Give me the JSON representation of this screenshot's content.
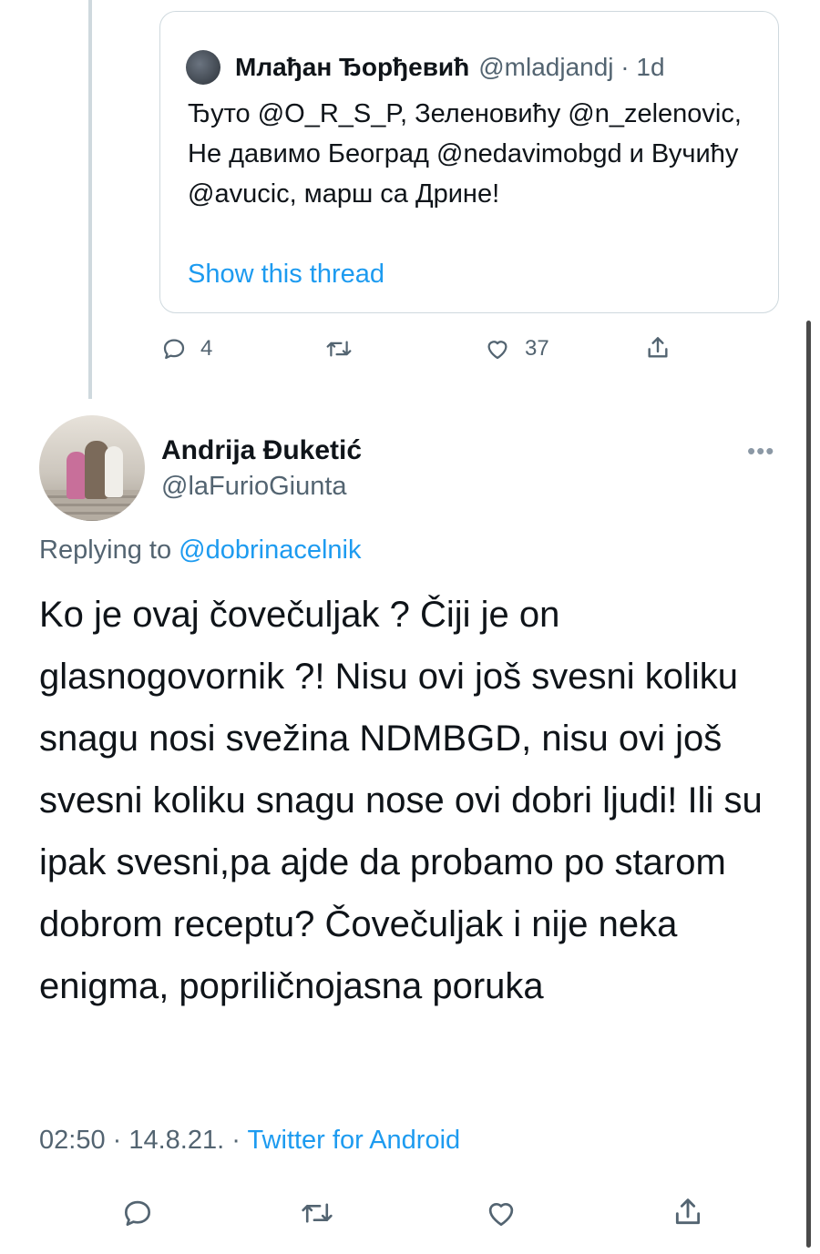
{
  "quoted_tweet": {
    "author_name": "Млађан Ђорђевић",
    "author_handle": "@mladjandj",
    "age": "1d",
    "text": "Ђуто @O_R_S_P, Зеленовићу @n_zelenovic, Не давимо Београд @nedavimobgd и Вучићу @avucic, марш са Дрине!",
    "show_thread": "Show this thread",
    "actions": {
      "reply_count": "4",
      "like_count": "37",
      "icons": [
        "reply-icon",
        "retweet-icon",
        "like-icon",
        "share-icon"
      ]
    }
  },
  "tweet": {
    "author_name": "Andrija Đuketić",
    "author_handle": "@laFurioGiunta",
    "more_label": "•••",
    "replying_prefix": "Replying to",
    "replying_to": "@dobrinacelnik",
    "text": "Ko je ovaj čovečuljak ? Čiji je on glasnogovornik ?! Nisu ovi još svesni koliku snagu nosi svežina NDMBGD, nisu ovi još svesni koliku snagu nose ovi dobri ljudi! Ili su ipak svesni,pa ajde da probamo po starom dobrom receptu? Čovečuljak i nije neka enigma, popriličnojasna poruka",
    "time": "02:50",
    "date": "14.8.21.",
    "source": "Twitter for Android",
    "icons": [
      "reply-icon",
      "retweet-icon",
      "like-icon",
      "share-icon"
    ]
  },
  "colors": {
    "link": "#1d9bf0",
    "secondary_text": "#536471",
    "primary_text": "#0f1419",
    "border": "#cfd9de"
  }
}
